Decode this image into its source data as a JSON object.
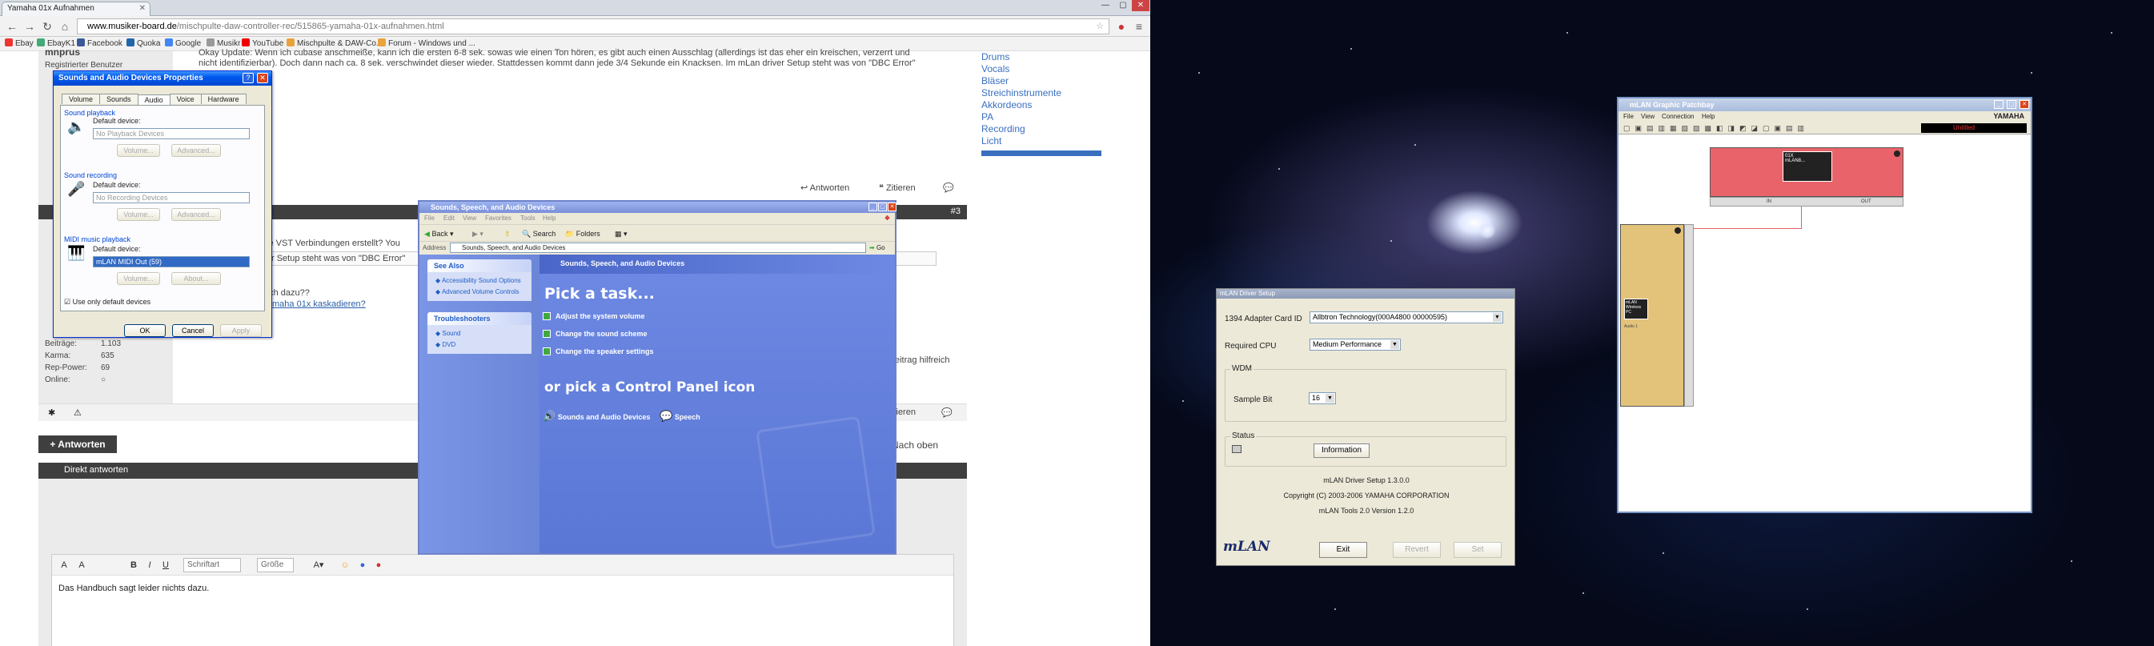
{
  "chrome": {
    "tab_title": "Yamaha 01x Aufnahmen",
    "url_host": "www.musiker-board.de",
    "url_path": "/mischpulte-daw-controller-rec/515865-yamaha-01x-aufnahmen.html",
    "bookmarks": [
      "Ebay",
      "EbayK1",
      "Facebook",
      "Quoka",
      "Google",
      "Musikr",
      "YouTube",
      "Mischpulte & DAW-Co...",
      "Forum - Windows und ..."
    ]
  },
  "forum": {
    "post_text_line1": "Okay Update: Wenn ich cubase anschmeiße, kann ich die ersten 6-8 sek. sowas wie einen Ton hören, es gibt auch einen Ausschlag (allerdings ist das eher ein kreischen, verzerrt und",
    "post_text_line2": "nicht identifizierbar). Doch dann nach ca. 8 sek. verschwindet dieser wieder. Stattdessen kommt dann jede 3/4 Sekunde ein Knacksen. Im mLan driver Setup steht was von \"DBC Error\"",
    "user_title": "Registrierter Benutzer",
    "user_name_fragment": "mnprus",
    "answer_label": "Antworten",
    "quote_label": "Zitieren",
    "post_number": "#3",
    "partial_q1": "se VST Verbindungen erstellt? You",
    "partial_q2": "r Setup steht was von \"DBC Error\"",
    "partial_q3": "uch dazu??",
    "partial_link": "maha 01x kaskadieren?",
    "stats": [
      {
        "label": "Beiträge:",
        "value": "1.103"
      },
      {
        "label": "Karma:",
        "value": "635"
      },
      {
        "label": "Rep-Power:",
        "value": "69"
      },
      {
        "label": "Online:",
        "value": "○"
      }
    ],
    "partial_right": "eitrag hilfreich",
    "partial_quote2": "itieren",
    "new_reply_button": "+ Antworten",
    "next_label": "Nach oben",
    "direct_reply_label": "Direkt antworten",
    "editor_font_label": "Schriftart",
    "editor_size_label": "Größe",
    "editor_text": "Das Handbuch sagt leider nichts dazu.",
    "sidenav": [
      "Drums",
      "Vocals",
      "Bläser",
      "Streichinstrumente",
      "Akkordeons",
      "PA",
      "Recording",
      "Licht"
    ]
  },
  "sound_props": {
    "title": "Sounds and Audio Devices Properties",
    "tabs": [
      "Volume",
      "Sounds",
      "Audio",
      "Voice",
      "Hardware"
    ],
    "active_tab": "Audio",
    "playback_group": "Sound playback",
    "playback_label": "Default device:",
    "playback_value": "No Playback Devices",
    "recording_group": "Sound recording",
    "recording_label": "Default device:",
    "recording_value": "No Recording Devices",
    "midi_group": "MIDI music playback",
    "midi_label": "Default device:",
    "midi_value": "mLAN MIDI Out (59)",
    "volume_btn": "Volume...",
    "advanced_btn": "Advanced...",
    "about_btn": "About...",
    "checkbox_label": "Use only default devices",
    "ok": "OK",
    "cancel": "Cancel",
    "apply": "Apply"
  },
  "control_panel": {
    "title": "Sounds, Speech, and Audio Devices",
    "menu": [
      "File",
      "Edit",
      "View",
      "Favorites",
      "Tools",
      "Help"
    ],
    "back": "Back",
    "search": "Search",
    "folders": "Folders",
    "address_label": "Address",
    "address_value": "Sounds, Speech, and Audio Devices",
    "go": "Go",
    "see_also_title": "See Also",
    "see_also_items": [
      "Accessibility Sound Options",
      "Advanced Volume Controls"
    ],
    "troubleshooters_title": "Troubleshooters",
    "troubleshooters_items": [
      "Sound",
      "DVD"
    ],
    "heading_bar": "Sounds, Speech, and Audio Devices",
    "pick_task": "Pick a task...",
    "tasks": [
      "Adjust the system volume",
      "Change the sound scheme",
      "Change the speaker settings"
    ],
    "pick_icon": "or pick a Control Panel icon",
    "icons": [
      "Sounds and Audio Devices",
      "Speech"
    ]
  },
  "mlan_setup": {
    "title": "mLAN Driver Setup",
    "adapter_label": "1394 Adapter Card ID",
    "adapter_value": "Allbtron Technology(000A4800 00000595)",
    "cpu_label": "Required CPU",
    "cpu_value": "Medium Performance",
    "wdm_group": "WDM",
    "sample_bit_label": "Sample Bit",
    "sample_bit_value": "16",
    "status_group": "Status",
    "info_button": "Information",
    "version_line": "mLAN Driver Setup 1.3.0.0",
    "copyright_line": "Copyright (C) 2003-2006 YAMAHA CORPORATION",
    "tools_line": "mLAN Tools 2.0 Version 1.2.0",
    "logo": "mLAN",
    "exit": "Exit",
    "revert": "Revert",
    "set": "Set"
  },
  "patchbay": {
    "title": "mLAN Graphic Patchbay",
    "menu": [
      "File",
      "View",
      "Connection",
      "Help"
    ],
    "brand": "YAMAHA",
    "status": "Untitled",
    "device_top_label": "01X",
    "device_top_sub": "mLAN8...",
    "device_left_label": "mLAN Wireless PC",
    "device_left_sub": "Audio 1",
    "in_label": "IN",
    "out_label": "OUT"
  },
  "colors": {
    "xp_blue": "#0058ee",
    "cp_blue": "#6f8ae0",
    "patch_red": "#e8646a",
    "patch_tan": "#e3c27a"
  }
}
